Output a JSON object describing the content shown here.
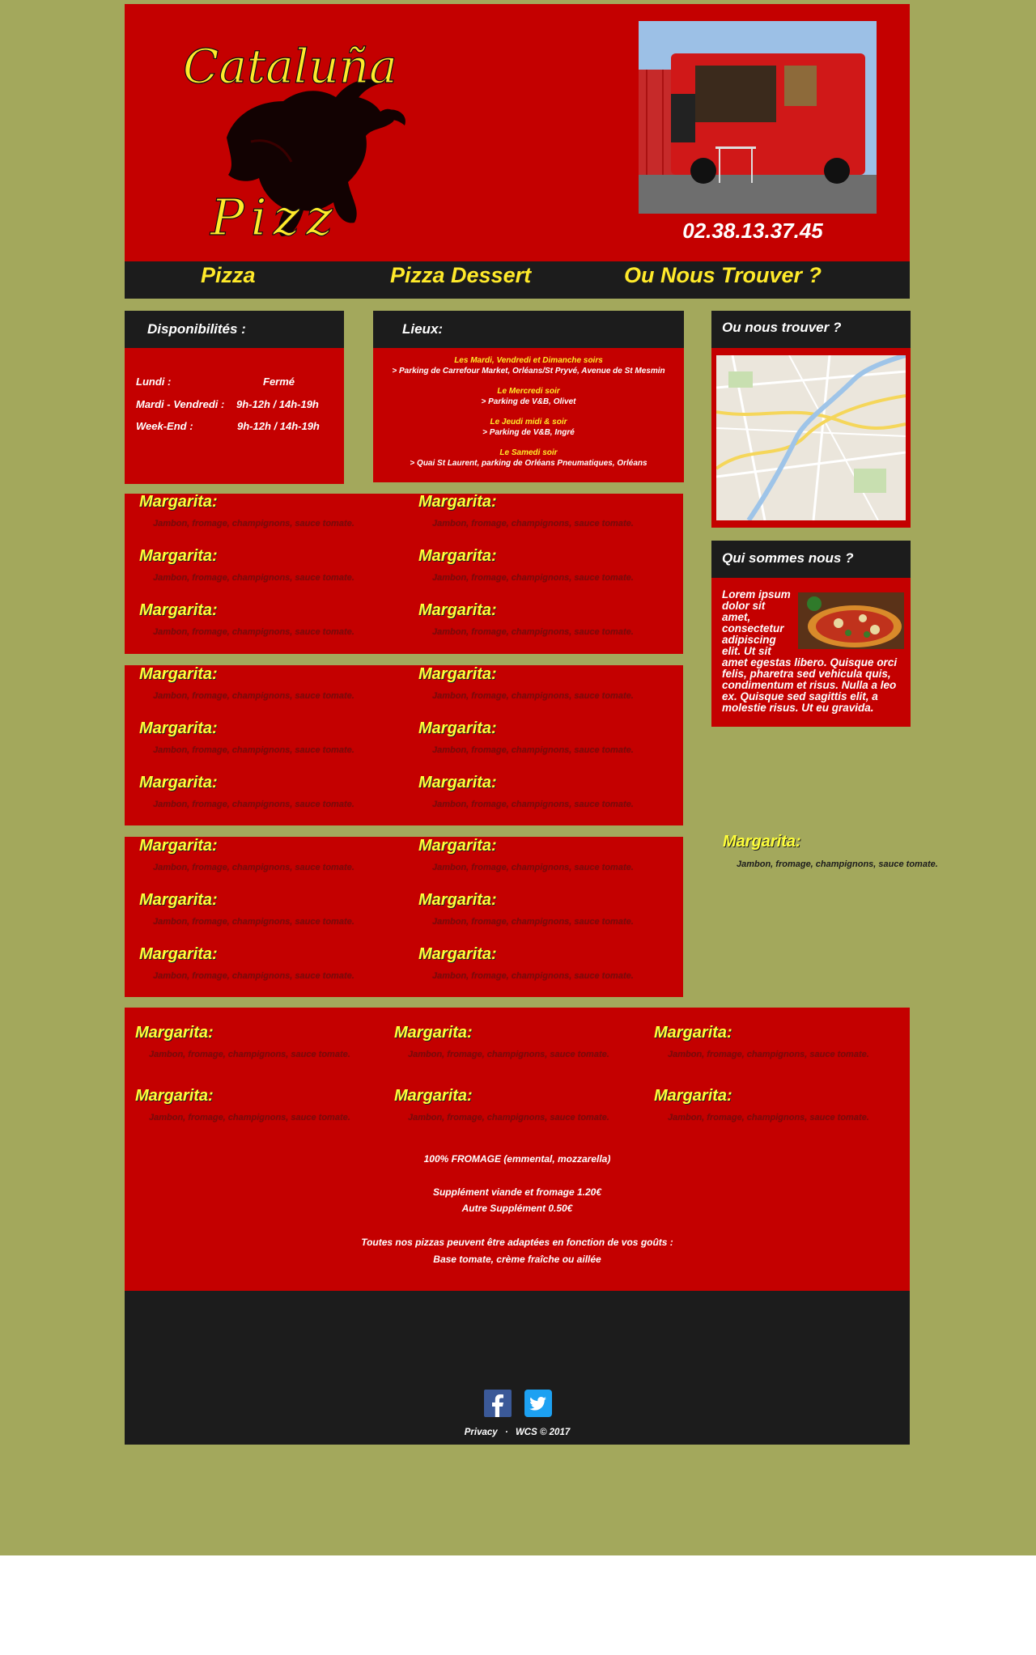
{
  "header": {
    "logo_top": "Cataluña",
    "logo_bottom": "Pizz",
    "phone": "02.38.13.37.45"
  },
  "nav": {
    "items": [
      {
        "label": "Pizza"
      },
      {
        "label": "Pizza Dessert"
      },
      {
        "label": "Ou Nous Trouver ?"
      }
    ]
  },
  "dispo": {
    "title": "Disponibilités :",
    "rows": [
      {
        "day": "Lundi :",
        "hours": "Fermé"
      },
      {
        "day": "Mardi - Vendredi :",
        "hours": "9h-12h / 14h-19h"
      },
      {
        "day": "Week-End :",
        "hours": "9h-12h / 14h-19h"
      }
    ]
  },
  "lieux": {
    "title": "Lieux:",
    "items": [
      {
        "when": "Les Mardi, Vendredi et Dimanche soirs",
        "where": "> Parking de Carrefour Market, Orléans/St Pryvé, Avenue de St Mesmin"
      },
      {
        "when": "Le Mercredi soir",
        "where": "> Parking de V&B, Olivet"
      },
      {
        "when": "Le Jeudi midi & soir",
        "where": "> Parking de V&B, Ingré"
      },
      {
        "when": "Le Samedi soir",
        "where": "> Quai St Laurent, parking de Orléans Pneumatiques, Orléans"
      }
    ]
  },
  "map_box": {
    "title": "Ou nous trouver ?"
  },
  "qui": {
    "title": "Qui sommes nous ?",
    "text_short": [
      "Lorem ipsum",
      "dolor sit",
      "amet,",
      "consectetur",
      "adipiscing",
      "elit. Ut sit"
    ],
    "text_long": [
      "amet egestas libero. Quisque orci",
      "felis, pharetra sed vehicula quis,",
      "condimentum et risus. Nulla a leo",
      "ex. Quisque sed sagittis elit, a",
      "molestie risus. Ut eu gravida."
    ]
  },
  "pizza": {
    "name": "Margarita:",
    "desc": "Jambon, fromage, champignons, sauce tomate."
  },
  "info": {
    "line1": "100% FROMAGE (emmental, mozzarella)",
    "line2": "Supplément viande et fromage 1.20€",
    "line3": "Autre Supplément 0.50€",
    "line4": "Toutes nos pizzas peuvent être adaptées en fonction de vos goûts :",
    "line5": "Base tomate, crème fraîche ou aillée"
  },
  "footer": {
    "privacy": "Privacy",
    "sep": "·",
    "copyright": "WCS © 2017"
  },
  "colors": {
    "olive": "#a3a85c",
    "red": "#c40000",
    "dark": "#1c1c1c",
    "yellow": "#ffea2a"
  }
}
